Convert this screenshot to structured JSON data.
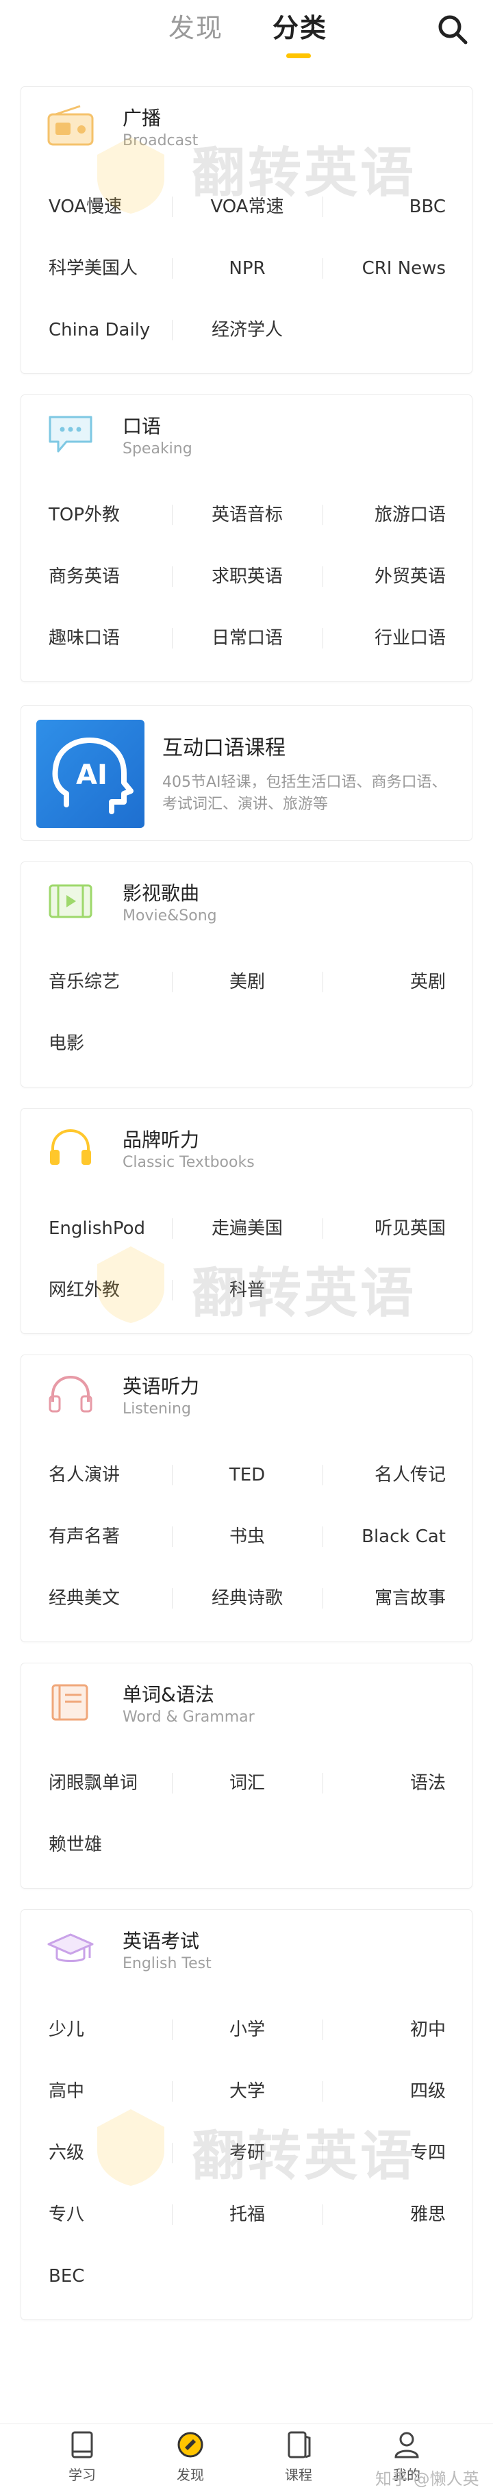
{
  "header": {
    "tab_find": "发现",
    "tab_category": "分类"
  },
  "watermark": "翻转英语",
  "sections": [
    {
      "title": "广播",
      "subtitle": "Broadcast",
      "icon": "radio-icon",
      "items": [
        "VOA慢速",
        "VOA常速",
        "BBC",
        "科学美国人",
        "NPR",
        "CRI News",
        "China Daily",
        "经济学人"
      ]
    },
    {
      "title": "口语",
      "subtitle": "Speaking",
      "icon": "chat-bubble-icon",
      "items": [
        "TOP外教",
        "英语音标",
        "旅游口语",
        "商务英语",
        "求职英语",
        "外贸英语",
        "趣味口语",
        "日常口语",
        "行业口语"
      ]
    },
    {
      "title": "影视歌曲",
      "subtitle": "Movie&Song",
      "icon": "film-icon",
      "items": [
        "音乐综艺",
        "美剧",
        "英剧",
        "电影"
      ]
    },
    {
      "title": "品牌听力",
      "subtitle": "Classic Textbooks",
      "icon": "headphones-icon",
      "items": [
        "EnglishPod",
        "走遍美国",
        "听见英国",
        "网红外教",
        "科普"
      ]
    },
    {
      "title": "英语听力",
      "subtitle": "Listening",
      "icon": "headphones-icon",
      "items": [
        "名人演讲",
        "TED",
        "名人传记",
        "有声名著",
        "书虫",
        "Black Cat",
        "经典美文",
        "经典诗歌",
        "寓言故事"
      ]
    },
    {
      "title": "单词&语法",
      "subtitle": "Word & Grammar",
      "icon": "book-icon",
      "items": [
        "闭眼飘单词",
        "词汇",
        "语法",
        "赖世雄"
      ]
    },
    {
      "title": "英语考试",
      "subtitle": "English Test",
      "icon": "graduation-cap-icon",
      "items": [
        "少儿",
        "小学",
        "初中",
        "高中",
        "大学",
        "四级",
        "六级",
        "考研",
        "专四",
        "专八",
        "托福",
        "雅思",
        "BEC"
      ]
    }
  ],
  "course": {
    "title": "互动口语课程",
    "description": "405节AI轻课，包括生活口语、商务口语、考试词汇、演讲、旅游等",
    "logo_text": "AI"
  },
  "bottom_nav": [
    {
      "label": "学习",
      "icon": "book-study-icon"
    },
    {
      "label": "发现",
      "icon": "discover-icon"
    },
    {
      "label": "课程",
      "icon": "course-icon"
    },
    {
      "label": "我的",
      "icon": "user-icon"
    }
  ],
  "footer_credit": "知乎 @懒人英语",
  "colors": {
    "accent": "#ffc400",
    "radio": "#f5c26b",
    "chat": "#7ec8e3",
    "film": "#9ed86b",
    "headphones_brand": "#ffc72c",
    "headphones_listening": "#e79aa6",
    "book": "#f0a77a",
    "cap": "#c9a2e8",
    "course_logo": "#2f8fe8"
  }
}
